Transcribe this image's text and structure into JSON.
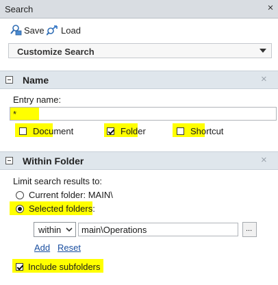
{
  "titlebar": {
    "title": "Search",
    "close_glyph": "×"
  },
  "toolbar": {
    "save_label": "Save",
    "load_label": "Load"
  },
  "customize": {
    "label": "Customize Search"
  },
  "name_section": {
    "title": "Name",
    "entry_label": "Entry name:",
    "entry_value": "*",
    "options": [
      {
        "label": "Document",
        "checked": false
      },
      {
        "label": "Folder",
        "checked": true
      },
      {
        "label": "Shortcut",
        "checked": false
      }
    ]
  },
  "folder_section": {
    "title": "Within Folder",
    "limit_label": "Limit search results to:",
    "current_folder_label": "Current folder: MAIN\\",
    "selected_folders_label": "Selected folders",
    "selected_folders_colon": ":",
    "scope_value": "within",
    "path_value": "main\\Operations",
    "browse_label": "...",
    "add_label": "Add",
    "reset_label": "Reset",
    "include_subfolders_label": "Include subfolders"
  },
  "colors": {
    "highlight": "#ffff00",
    "header_bg": "#dfe6ec",
    "link": "#1a4fa0"
  }
}
